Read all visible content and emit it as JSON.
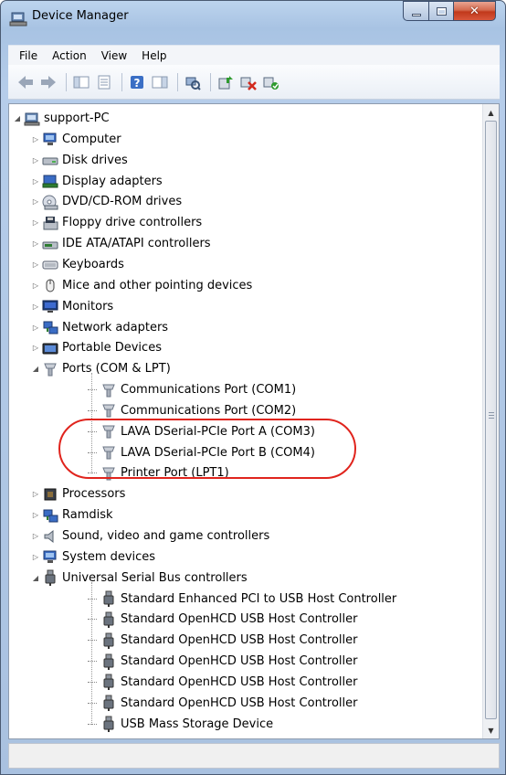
{
  "window": {
    "title": "Device Manager"
  },
  "menu": [
    "File",
    "Action",
    "View",
    "Help"
  ],
  "toolbar": {
    "buttons": [
      "back-icon",
      "forward-icon",
      "show-hide-console-tree-icon",
      "properties-icon",
      "help-icon",
      "show-action-pane-icon",
      "scan-hardware-icon",
      "update-driver-icon",
      "uninstall-icon",
      "enable-device-icon"
    ]
  },
  "tree": {
    "root": "support-PC",
    "items": [
      {
        "label": "Computer",
        "icon": "computer-icon",
        "level": 1
      },
      {
        "label": "Disk drives",
        "icon": "disk-drive-icon",
        "level": 1
      },
      {
        "label": "Display adapters",
        "icon": "display-adapter-icon",
        "level": 1
      },
      {
        "label": "DVD/CD-ROM drives",
        "icon": "dvd-drive-icon",
        "level": 1
      },
      {
        "label": "Floppy drive controllers",
        "icon": "floppy-controller-icon",
        "level": 1
      },
      {
        "label": "IDE ATA/ATAPI controllers",
        "icon": "ide-controller-icon",
        "level": 1
      },
      {
        "label": "Keyboards",
        "icon": "keyboard-icon",
        "level": 1
      },
      {
        "label": "Mice and other pointing devices",
        "icon": "mouse-icon",
        "level": 1
      },
      {
        "label": "Monitors",
        "icon": "monitor-icon",
        "level": 1
      },
      {
        "label": "Network adapters",
        "icon": "network-adapter-icon",
        "level": 1
      },
      {
        "label": "Portable Devices",
        "icon": "portable-device-icon",
        "level": 1
      },
      {
        "label": "Ports (COM & LPT)",
        "icon": "port-icon",
        "level": 1,
        "expanded": true
      },
      {
        "label": "Communications Port (COM1)",
        "icon": "port-icon",
        "level": 2
      },
      {
        "label": "Communications Port (COM2)",
        "icon": "port-icon",
        "level": 2
      },
      {
        "label": "LAVA DSerial-PCIe Port A (COM3)",
        "icon": "port-icon",
        "level": 2
      },
      {
        "label": "LAVA DSerial-PCIe Port B (COM4)",
        "icon": "port-icon",
        "level": 2
      },
      {
        "label": "Printer Port (LPT1)",
        "icon": "port-icon",
        "level": 2
      },
      {
        "label": "Processors",
        "icon": "processor-icon",
        "level": 1
      },
      {
        "label": "Ramdisk",
        "icon": "ramdisk-icon",
        "level": 1
      },
      {
        "label": "Sound, video and game controllers",
        "icon": "sound-icon",
        "level": 1
      },
      {
        "label": "System devices",
        "icon": "system-device-icon",
        "level": 1
      },
      {
        "label": "Universal Serial Bus controllers",
        "icon": "usb-icon",
        "level": 1,
        "expanded": true
      },
      {
        "label": "Standard Enhanced PCI to USB Host Controller",
        "icon": "usb-icon",
        "level": 2
      },
      {
        "label": "Standard OpenHCD USB Host Controller",
        "icon": "usb-icon",
        "level": 2
      },
      {
        "label": "Standard OpenHCD USB Host Controller",
        "icon": "usb-icon",
        "level": 2
      },
      {
        "label": "Standard OpenHCD USB Host Controller",
        "icon": "usb-icon",
        "level": 2
      },
      {
        "label": "Standard OpenHCD USB Host Controller",
        "icon": "usb-icon",
        "level": 2
      },
      {
        "label": "Standard OpenHCD USB Host Controller",
        "icon": "usb-icon",
        "level": 2
      },
      {
        "label": "USB Mass Storage Device",
        "icon": "usb-icon",
        "level": 2
      }
    ]
  },
  "annotation": {
    "color": "#e0241d"
  },
  "status": ""
}
